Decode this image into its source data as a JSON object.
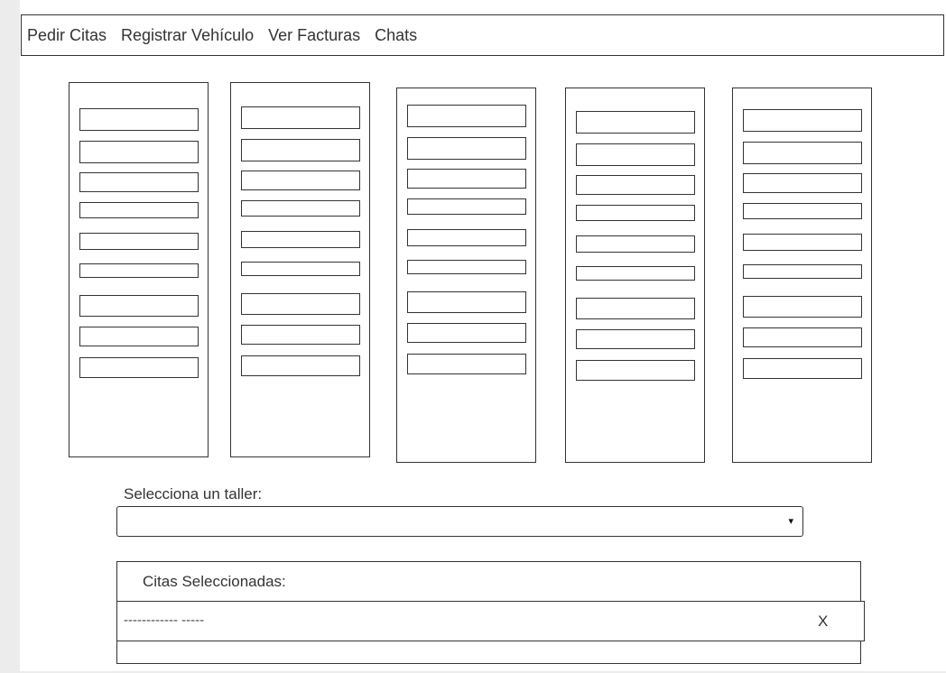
{
  "nav": {
    "items": [
      "Pedir Citas",
      "Registrar Vehículo",
      "Ver Facturas",
      "Chats"
    ]
  },
  "schedule": {
    "columns": 5,
    "slots_per_column": 9
  },
  "taller": {
    "label": "Selecciona un taller:",
    "selected": "",
    "arrow_icon": "▾"
  },
  "citas": {
    "title": "Citas Seleccionadas:",
    "items": [
      {
        "text": "------------ -----",
        "remove_label": "X"
      }
    ]
  }
}
